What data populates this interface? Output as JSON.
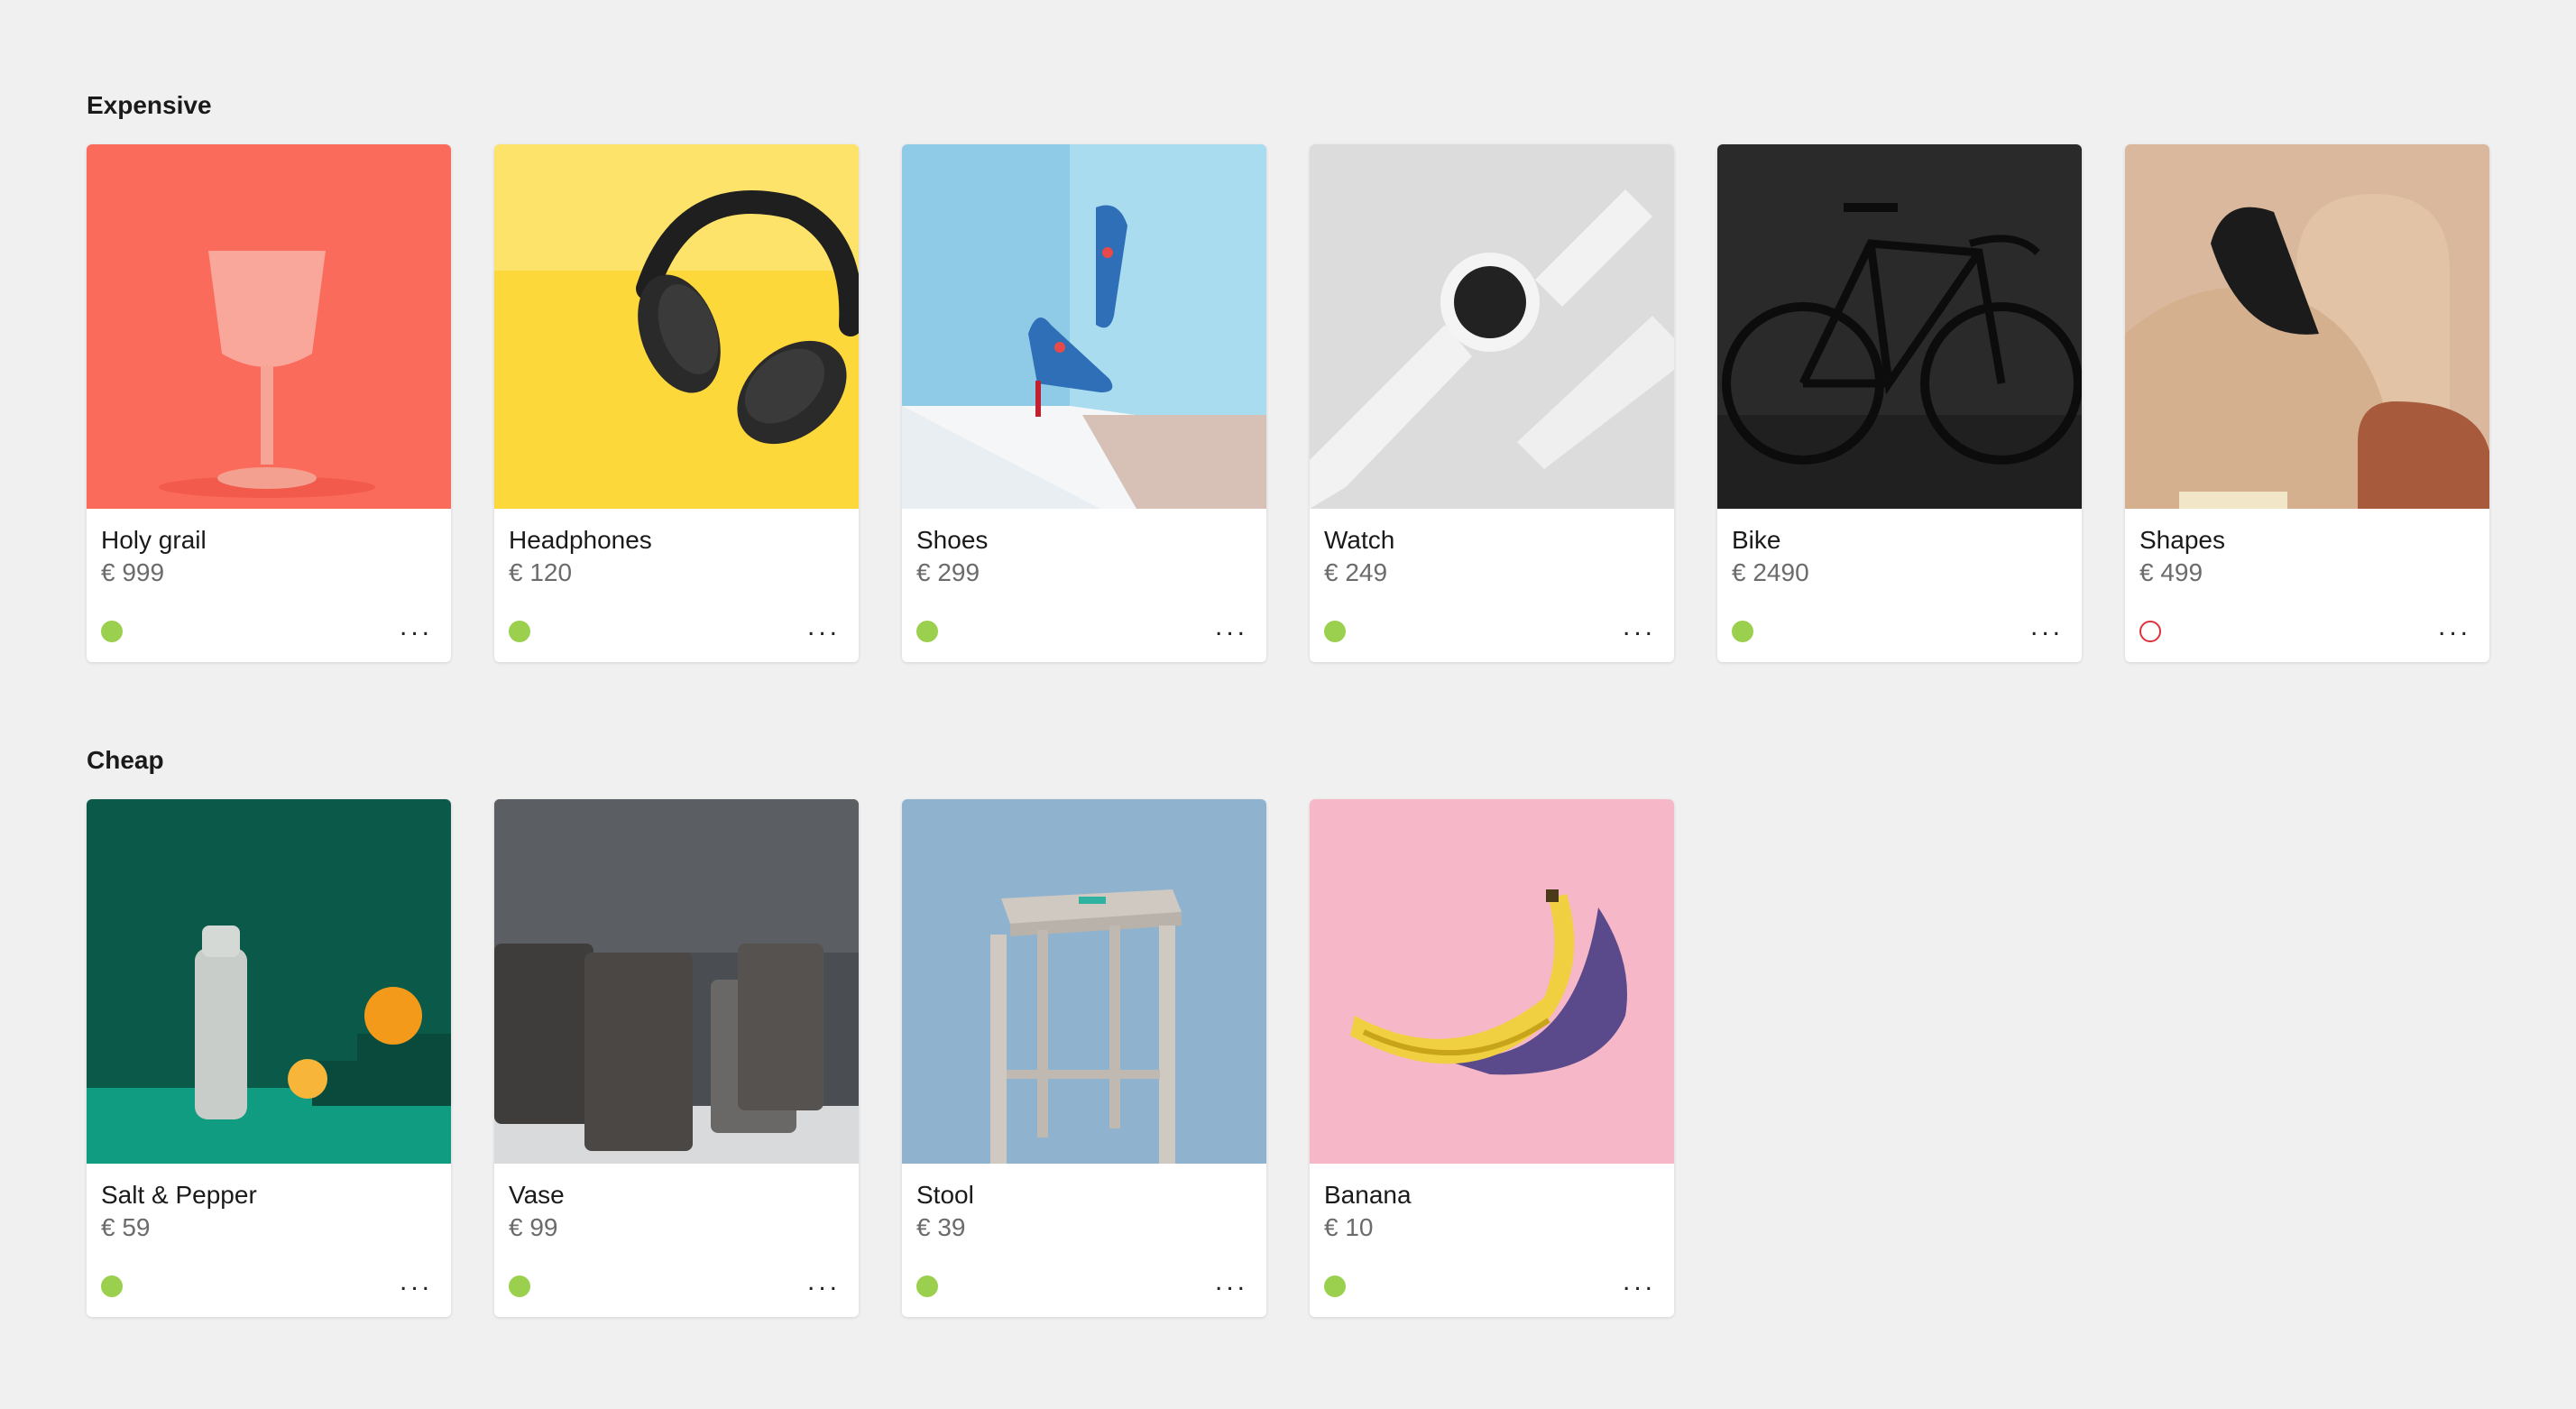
{
  "sections": [
    {
      "title": "Expensive",
      "items": [
        {
          "name": "Holy grail",
          "price": "€ 999",
          "status": "available",
          "image": "goblet"
        },
        {
          "name": "Headphones",
          "price": "€ 120",
          "status": "available",
          "image": "headphones"
        },
        {
          "name": "Shoes",
          "price": "€ 299",
          "status": "available",
          "image": "shoes"
        },
        {
          "name": "Watch",
          "price": "€ 249",
          "status": "available",
          "image": "watch"
        },
        {
          "name": "Bike",
          "price": "€ 2490",
          "status": "available",
          "image": "bike"
        },
        {
          "name": "Shapes",
          "price": "€ 499",
          "status": "unavailable",
          "image": "shapes"
        }
      ]
    },
    {
      "title": "Cheap",
      "items": [
        {
          "name": "Salt & Pepper",
          "price": "€ 59",
          "status": "available",
          "image": "bottle"
        },
        {
          "name": "Vase",
          "price": "€ 99",
          "status": "available",
          "image": "vases"
        },
        {
          "name": "Stool",
          "price": "€ 39",
          "status": "available",
          "image": "stool"
        },
        {
          "name": "Banana",
          "price": "€ 10",
          "status": "available",
          "image": "banana"
        }
      ]
    }
  ],
  "more_label": "...",
  "colors": {
    "background": "#f0f0f0",
    "status_available": "#9bd04e",
    "status_unavailable": "#e0303a"
  }
}
